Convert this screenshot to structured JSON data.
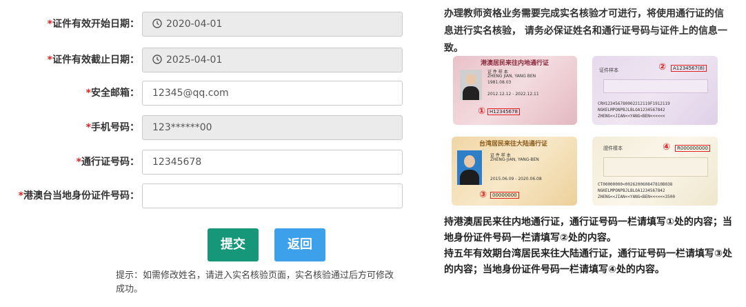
{
  "form": {
    "required_mark": "*",
    "start_date": {
      "label": "证件有效开始日期：",
      "value": "2020-04-01"
    },
    "end_date": {
      "label": "证件有效截止日期：",
      "value": "2025-04-01"
    },
    "email": {
      "label": "安全邮箱：",
      "value": "12345@qq.com"
    },
    "phone": {
      "label": "手机号码：",
      "value": "123******00"
    },
    "permit_no": {
      "label": "通行证号码：",
      "value": "12345678"
    },
    "local_id": {
      "label": "港澳台当地身份证件号码：",
      "value": ""
    }
  },
  "buttons": {
    "submit": {
      "label": "提交",
      "color": "#16977a"
    },
    "back": {
      "label": "返回",
      "color": "#3da0ea"
    }
  },
  "hint": "提示：如需修改姓名，请进入实名核验页面，实名核验通过后方可修改成功。",
  "side": {
    "intro": "办理教师资格业务需要完成实名核验才可进行，将使用通行证的信息进行实名核验， 请务必保证姓名和通行证号码与证件上的信息一致。",
    "note_hk": "持港澳居民来往内地通行证，通行证号码一栏请填写①处的内容；当地身份证件号码一栏请填写②处的内容。",
    "note_tw": "持五年有效期台湾居民来往大陆通行证，通行证号码一栏请填写③处的内容；当地身份证件号码一栏请填写④处的内容。",
    "cards": {
      "hk_front": {
        "title": "港澳居民来往内地通行证",
        "lines": [
          "证 件 样 本",
          "ZHENG JIAN, YANG BEN",
          "1981.08.03",
          "2012.12.12 - 2022.12.11"
        ],
        "marker": "①",
        "number": "H12345678"
      },
      "hk_back": {
        "title": "证件样本",
        "marker": "②",
        "number": "A1234567(8)",
        "mrz": [
          "CRH123456780002212119F1912119",
          "NGKELMPONPBJLBLOA1234567842",
          "ZHENG<<JIAN<<YANG<BEN<<<<<<"
        ]
      },
      "tw_front": {
        "title": "台湾居民来往大陆通行证",
        "lines": [
          "证 件 样 本",
          "ZHENG-JIAN, YANG-BEN",
          "2015.06.09 - 2020.06.08"
        ],
        "marker": "③",
        "number": "00000000"
      },
      "tw_back": {
        "title": "證件樣本",
        "marker": "④",
        "number": "R000000000",
        "mrz": [
          "CT00000000<002620060847810B038",
          "NGKELMPONPBJLBLOA1234567842",
          "ZHENG<<JIAN<<YANG<BEN<<<<<<3500"
        ]
      }
    }
  }
}
